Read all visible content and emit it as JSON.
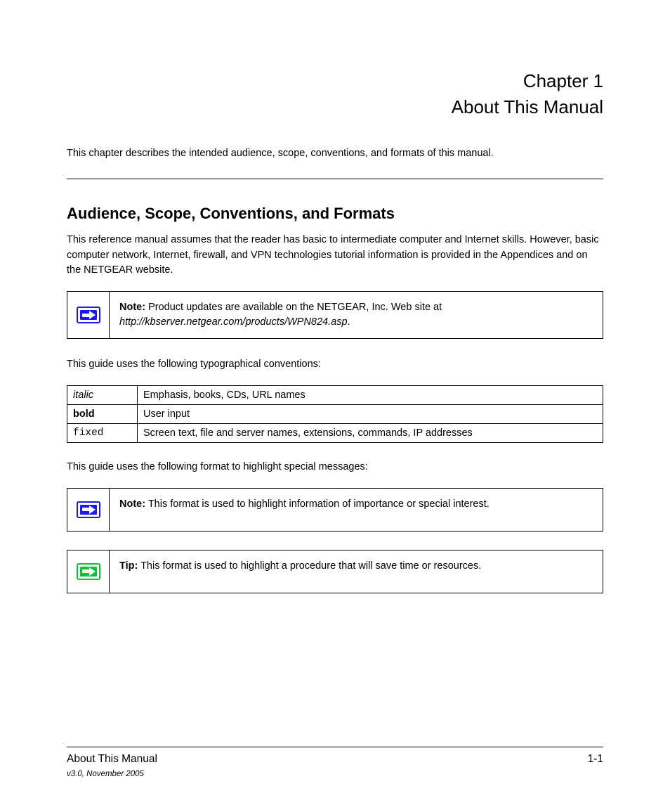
{
  "chapter": {
    "label": "Chapter 1",
    "title": "About This Manual"
  },
  "intro_para": "This chapter describes the intended audience, scope, conventions, and formats of this manual.",
  "sections": {
    "audience": {
      "heading": "Audience, Scope, Conventions, and Formats",
      "para": "This reference manual assumes that the reader has basic to intermediate computer and Internet skills. However, basic computer network, Internet, firewall, and VPN technologies tutorial information is provided in the Appendices and on the NETGEAR website."
    },
    "conventions": {
      "lead": "This guide uses the following typographical conventions:"
    },
    "format_lead": "This guide uses the following format to highlight special messages:"
  },
  "typo_table": {
    "rows": [
      {
        "style": "italic",
        "desc": "Emphasis, books, CDs, URL names"
      },
      {
        "style": "bold",
        "desc": "User input"
      },
      {
        "style": "fixed",
        "desc": "Screen text, file and server names, extensions, commands, IP addresses"
      }
    ]
  },
  "callouts": {
    "scope_note": {
      "label": "Note:",
      "text": " Product updates are available on the NETGEAR, Inc. Web site at ",
      "link": "http://kbserver.netgear.com/products/WPN824.asp",
      "tail": "."
    },
    "format_note": {
      "label": "Note:",
      "text": " This format is used to highlight information of importance or special interest."
    },
    "format_tip": {
      "label": "Tip:",
      "text": " This format is used to highlight a procedure that will save time or resources."
    }
  },
  "footer": {
    "left": "About This Manual",
    "right": "1-1",
    "version": "v3.0, November 2005"
  }
}
